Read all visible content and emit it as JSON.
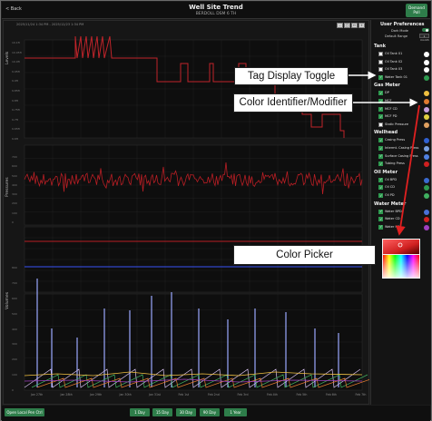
{
  "header": {
    "back_label": "< Back",
    "title": "Well Site Trend",
    "subtitle": "BERDOLL DSM 6 TH",
    "demand_poll_label": "Demand Poll",
    "date_range": "2025/11/24 1:34 PM - 2025/12/23 1:34 PM",
    "zoom_tools": [
      "-",
      "□",
      "↔",
      "+"
    ]
  },
  "chart": {
    "panel_labels": [
      "Levels",
      "Pressures",
      "Volumes"
    ],
    "levels_ticks": [
      "10.1ft",
      "10.05ft",
      "10.0ft",
      "9.95ft",
      "9.9ft",
      "9.85ft",
      "9.8ft",
      "9.75ft",
      "9.7ft",
      "9.65ft",
      "9.6ft"
    ],
    "pressure_ticks": [
      "700",
      "600",
      "500",
      "400",
      "300",
      "200",
      "100",
      "0"
    ],
    "volume_ticks": [
      "800",
      "700",
      "600",
      "500",
      "400",
      "300",
      "200",
      "100",
      "0"
    ],
    "x_ticks": [
      "Jan 27th",
      "Jan 28th",
      "Jan 29th",
      "Jan 30th",
      "Jan 31st",
      "Feb 1st",
      "Feb 2nd",
      "Feb 3rd",
      "Feb 4th",
      "Feb 5th",
      "Feb 6th",
      "Feb 7th"
    ]
  },
  "sidebar": {
    "title": "User Preferences",
    "dark_mode_label": "Dark Mode",
    "default_range_label": "Default Range",
    "default_range_value": "1 month",
    "groups": [
      {
        "name": "Tank",
        "tags": [
          {
            "label": "Oil Tank 01",
            "checked": false,
            "color": "#ffffff"
          },
          {
            "label": "Oil Tank 02",
            "checked": false,
            "color": "#ffffff"
          },
          {
            "label": "Oil Tank 03",
            "checked": false,
            "color": "#ffffff"
          },
          {
            "label": "Water Tank 01",
            "checked": true,
            "color": "#2e9a4f"
          }
        ]
      },
      {
        "name": "Gas Meter",
        "tags": [
          {
            "label": "DP",
            "checked": true,
            "color": "#f0c040"
          },
          {
            "label": "MCF",
            "checked": true,
            "color": "#e07a30"
          },
          {
            "label": "MCF CD",
            "checked": true,
            "color": "#c8a0e0"
          },
          {
            "label": "MCF PD",
            "checked": true,
            "color": "#e0d040"
          },
          {
            "label": "Static Pressure",
            "checked": false,
            "color": "#e0a060"
          }
        ]
      },
      {
        "name": "Wellhead",
        "tags": [
          {
            "label": "Casing Press",
            "checked": true,
            "color": "#3060d0"
          },
          {
            "label": "Intermt. Casing Press",
            "checked": true,
            "color": "#7aa0e0"
          },
          {
            "label": "Surface Casing Press",
            "checked": true,
            "color": "#5080e0"
          },
          {
            "label": "Tubing Press",
            "checked": true,
            "color": "#d02020"
          }
        ]
      },
      {
        "name": "Oil Meter",
        "tags": [
          {
            "label": "Oil BPD",
            "checked": true,
            "color": "#3a6ad0"
          },
          {
            "label": "Oil CD",
            "checked": true,
            "color": "#2e9a4f"
          },
          {
            "label": "Oil PD",
            "checked": true,
            "color": "#40b060"
          }
        ]
      },
      {
        "name": "Water Meter",
        "tags": [
          {
            "label": "Water BPD",
            "checked": true,
            "color": "#4a70d8"
          },
          {
            "label": "Water CD",
            "checked": true,
            "color": "#d02020"
          },
          {
            "label": "Water PD",
            "checked": true,
            "color": "#a040c0"
          }
        ]
      }
    ]
  },
  "callouts": {
    "tag_display_toggle": "Tag Display Toggle",
    "color_identifier": "Color Identifier/Modifier",
    "color_picker": "Color Picker"
  },
  "footer": {
    "open_local_label": "Open Local Pen Ctrl",
    "range_buttons": [
      "1 Day",
      "15 Day",
      "30 Day",
      "90 Day",
      "1 Year"
    ]
  },
  "colors": {
    "accent_green": "#2e7d4a",
    "levels_line": "#c0242a",
    "pressure_line": "#b81e24",
    "casing_press": "#3046c8"
  }
}
